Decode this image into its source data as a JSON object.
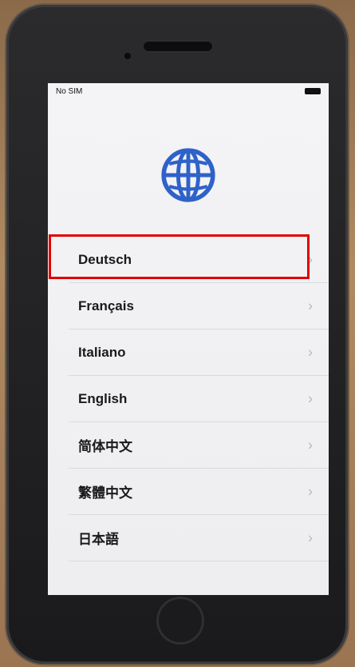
{
  "status_bar": {
    "carrier": "No SIM"
  },
  "languages": [
    {
      "label": "Deutsch"
    },
    {
      "label": "Français"
    },
    {
      "label": "Italiano"
    },
    {
      "label": "English"
    },
    {
      "label": "简体中文"
    },
    {
      "label": "繁體中文"
    },
    {
      "label": "日本語"
    }
  ],
  "icons": {
    "globe": "globe-icon",
    "chevron": "chevron-right-icon"
  },
  "colors": {
    "globe_blue": "#2f62c9",
    "highlight_red": "#e00000"
  }
}
